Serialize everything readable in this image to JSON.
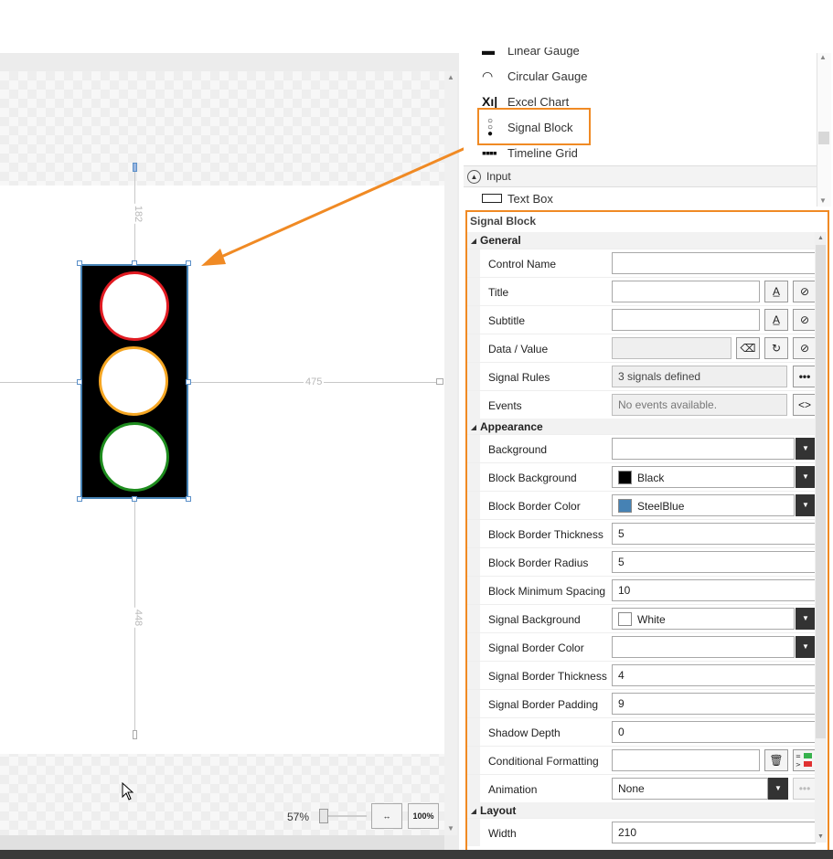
{
  "toolbox": {
    "items": [
      {
        "label": "Linear Gauge",
        "icon": "linear-gauge-icon"
      },
      {
        "label": "Circular Gauge",
        "icon": "circular-gauge-icon"
      },
      {
        "label": "Excel Chart",
        "icon": "excel-chart-icon"
      },
      {
        "label": "Signal Block",
        "icon": "signal-block-icon"
      },
      {
        "label": "Timeline Grid",
        "icon": "timeline-grid-icon"
      }
    ],
    "group": {
      "label": "Input",
      "icon": "collapse-circle-icon"
    },
    "group_items": [
      {
        "label": "Text Box",
        "icon": "text-box-icon"
      }
    ]
  },
  "canvas": {
    "dim_top": "182",
    "dim_right": "475",
    "dim_bottom": "448",
    "zoom": "57%",
    "fit_label": "↔",
    "actual_size_label": "100%",
    "signal_colors": {
      "red": "#e11b22",
      "amber": "#f5a623",
      "green": "#1e8c1e",
      "block": "#000000",
      "border": "#4682b4"
    }
  },
  "properties": {
    "title": "Signal Block",
    "sections": {
      "general": "General",
      "appearance": "Appearance",
      "layout": "Layout"
    },
    "general": {
      "control_name": {
        "label": "Control Name",
        "value": ""
      },
      "title": {
        "label": "Title",
        "value": ""
      },
      "subtitle": {
        "label": "Subtitle",
        "value": ""
      },
      "data_value": {
        "label": "Data / Value",
        "value": ""
      },
      "signal_rules": {
        "label": "Signal Rules",
        "value": "3 signals defined",
        "btn": "•••"
      },
      "events": {
        "label": "Events",
        "value": "No events available.",
        "btn": "<>"
      }
    },
    "appearance": {
      "background": {
        "label": "Background",
        "value": ""
      },
      "block_background": {
        "label": "Block Background",
        "value": "Black",
        "color": "#000000"
      },
      "block_border_color": {
        "label": "Block Border Color",
        "value": "SteelBlue",
        "color": "#4682b4"
      },
      "block_border_thickness": {
        "label": "Block Border Thickness",
        "value": "5"
      },
      "block_border_radius": {
        "label": "Block Border Radius",
        "value": "5"
      },
      "block_minimum_spacing": {
        "label": "Block Minimum Spacing",
        "value": "10"
      },
      "signal_background": {
        "label": "Signal Background",
        "value": "White",
        "color": "#ffffff"
      },
      "signal_border_color": {
        "label": "Signal Border Color",
        "value": ""
      },
      "signal_border_thickness": {
        "label": "Signal Border Thickness",
        "value": "4"
      },
      "signal_border_padding": {
        "label": "Signal Border Padding",
        "value": "9"
      },
      "shadow_depth": {
        "label": "Shadow Depth",
        "value": "0"
      },
      "conditional_formatting": {
        "label": "Conditional Formatting",
        "value": ""
      },
      "animation": {
        "label": "Animation",
        "value": "None"
      }
    },
    "layout": {
      "width": {
        "label": "Width",
        "value": "210"
      }
    },
    "accent_color": "#f08a24"
  }
}
